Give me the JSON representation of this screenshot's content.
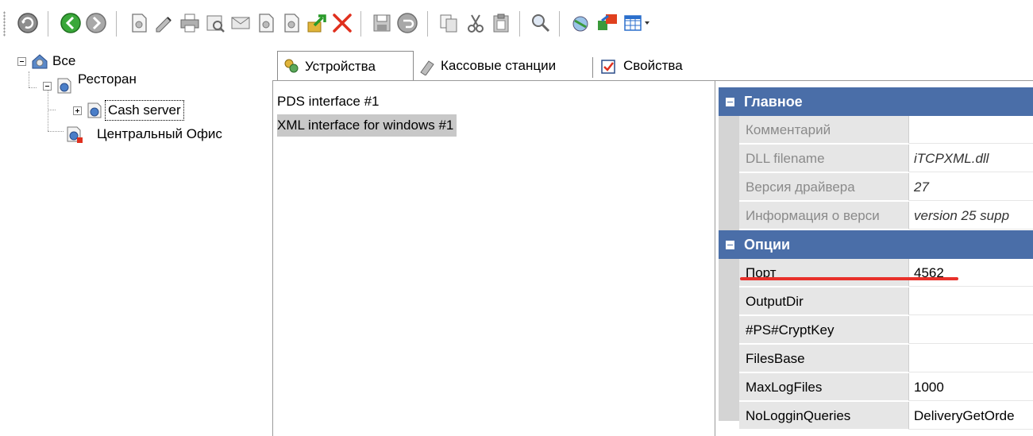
{
  "toolbar": {
    "icons": [
      "refresh-icon",
      "back-icon",
      "forward-icon",
      "document-icon",
      "edit-icon",
      "print-icon",
      "print-preview-icon",
      "mail-icon",
      "page-icon",
      "page-copy-icon",
      "export-icon",
      "delete-icon",
      "save-icon",
      "undo-icon",
      "copy-icon",
      "cut-icon",
      "paste-icon",
      "search-icon",
      "network-icon",
      "transfer-icon",
      "grid-view-icon"
    ]
  },
  "tree": {
    "root": {
      "label": "Все"
    },
    "restaurant": {
      "label": "Ресторан"
    },
    "cash_server": {
      "label": "Cash server"
    },
    "central_office": {
      "label": "Центральный Офис"
    }
  },
  "tabs": [
    {
      "label": "Устройства",
      "active": true
    },
    {
      "label": "Кассовые станции",
      "active": false
    },
    {
      "label": "Свойства",
      "active": false
    }
  ],
  "devices": [
    {
      "label": "PDS interface #1",
      "selected": false
    },
    {
      "label": "XML interface for windows #1",
      "selected": true
    }
  ],
  "properties": {
    "main": {
      "title": "Главное",
      "rows": [
        {
          "name": "Комментарий",
          "value": ""
        },
        {
          "name": "DLL filename",
          "value": "iTCPXML.dll"
        },
        {
          "name": "Версия драйвера",
          "value": "27"
        },
        {
          "name": "Информация о верси",
          "value": "version 25 supp"
        }
      ]
    },
    "options": {
      "title": "Опции",
      "rows": [
        {
          "name": "Порт",
          "value": "4562"
        },
        {
          "name": "OutputDir",
          "value": ""
        },
        {
          "name": "#PS#CryptKey",
          "value": ""
        },
        {
          "name": "FilesBase",
          "value": ""
        },
        {
          "name": "MaxLogFiles",
          "value": "1000"
        },
        {
          "name": "NoLogginQueries",
          "value": "DeliveryGetOrde"
        }
      ]
    }
  },
  "colors": {
    "category_header": "#4a6ea8",
    "selection": "#c8c8c8",
    "highlight_mark": "#e8302a"
  }
}
